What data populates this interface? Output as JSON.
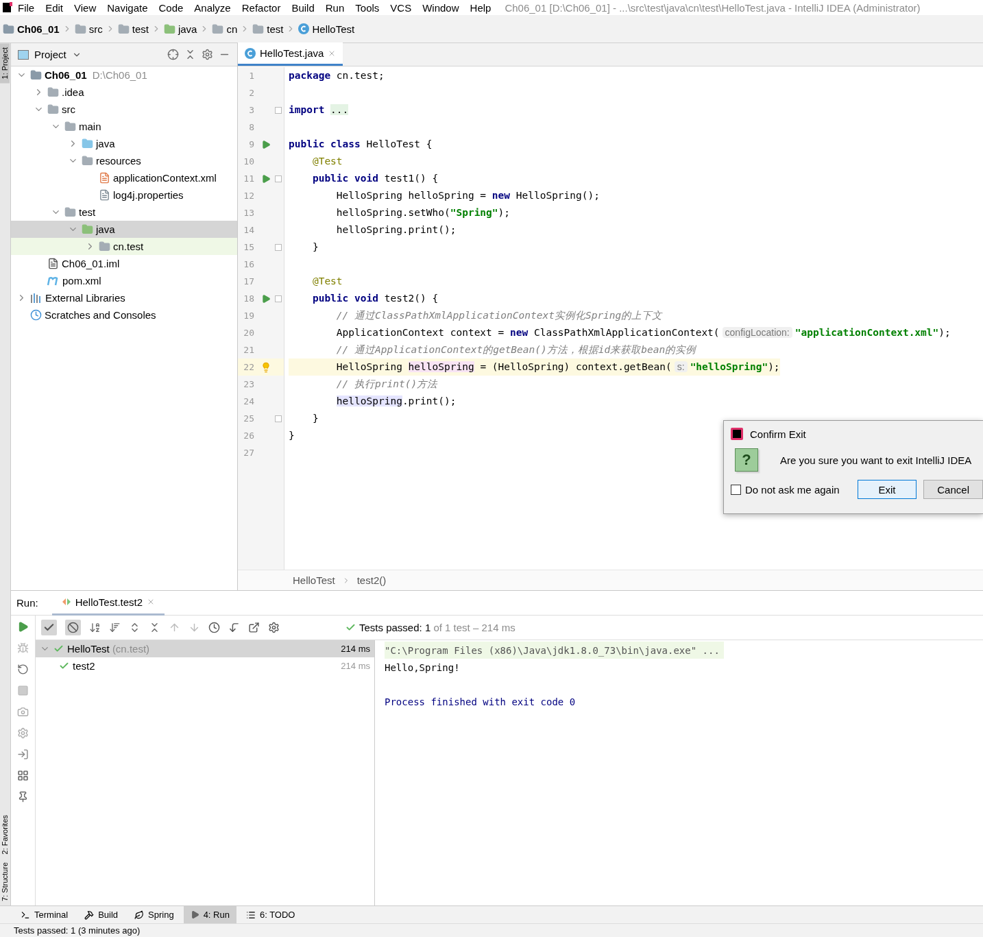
{
  "menu": [
    "File",
    "Edit",
    "View",
    "Navigate",
    "Code",
    "Analyze",
    "Refactor",
    "Build",
    "Run",
    "Tools",
    "VCS",
    "Window",
    "Help"
  ],
  "window": {
    "title": "Ch06_01 [D:\\Ch06_01] - ...\\src\\test\\java\\cn\\test\\HelloTest.java - IntelliJ IDEA (Administrator)"
  },
  "breadcrumbs": [
    {
      "label": "Ch06_01",
      "kind": "module"
    },
    {
      "label": "src",
      "kind": "folder"
    },
    {
      "label": "test",
      "kind": "folder"
    },
    {
      "label": "java",
      "kind": "test-folder"
    },
    {
      "label": "cn",
      "kind": "package"
    },
    {
      "label": "test",
      "kind": "package"
    },
    {
      "label": "HelloTest",
      "kind": "class"
    }
  ],
  "side_strip": {
    "top": [
      {
        "label": "1: Project",
        "selected": true
      }
    ],
    "bottom": [
      {
        "label": "2: Favorites",
        "selected": false
      },
      {
        "label": "7: Structure",
        "selected": false
      }
    ]
  },
  "project": {
    "title": "Project",
    "tree": [
      {
        "label": "Ch06_01",
        "path": "D:\\Ch06_01",
        "kind": "module",
        "expanded": true,
        "selected": false,
        "children": [
          {
            "label": ".idea",
            "kind": "folder",
            "expanded": false,
            "selected": false
          },
          {
            "label": "src",
            "kind": "folder",
            "expanded": true,
            "selected": false,
            "children": [
              {
                "label": "main",
                "kind": "folder",
                "expanded": true,
                "selected": false,
                "children": [
                  {
                    "label": "java",
                    "kind": "source-folder",
                    "expanded": false,
                    "selected": false
                  },
                  {
                    "label": "resources",
                    "kind": "resources-folder",
                    "expanded": true,
                    "selected": false,
                    "children": [
                      {
                        "label": "applicationContext.xml",
                        "kind": "xml",
                        "selected": false
                      },
                      {
                        "label": "log4j.properties",
                        "kind": "properties",
                        "selected": false
                      }
                    ]
                  }
                ]
              },
              {
                "label": "test",
                "kind": "folder",
                "expanded": true,
                "selected": false,
                "children": [
                  {
                    "label": "java",
                    "kind": "test-folder",
                    "expanded": true,
                    "selected": true,
                    "children": [
                      {
                        "label": "cn.test",
                        "kind": "package",
                        "expanded": false,
                        "selected": false,
                        "tinted": true
                      }
                    ]
                  }
                ]
              }
            ]
          },
          {
            "label": "Ch06_01.iml",
            "kind": "iml",
            "selected": false
          },
          {
            "label": "pom.xml",
            "kind": "maven",
            "selected": false
          }
        ]
      },
      {
        "label": "External Libraries",
        "kind": "libraries",
        "expanded": false,
        "selected": false
      },
      {
        "label": "Scratches and Consoles",
        "kind": "scratches",
        "selected": false
      }
    ]
  },
  "editor": {
    "tabs": [
      {
        "label": "HelloTest.java",
        "selected": true
      }
    ],
    "lines": [
      {
        "number": "1",
        "tokens": [
          {
            "kind": "kw",
            "text": "package"
          },
          {
            "kind": "plain",
            "text": " cn.test;"
          }
        ]
      },
      {
        "number": "2"
      },
      {
        "number": "3",
        "fold": true,
        "tokens": [
          {
            "kind": "kw",
            "text": "import "
          },
          {
            "kind": "folded",
            "text": "..."
          }
        ]
      },
      {
        "number": "8"
      },
      {
        "number": "9",
        "runnable": true,
        "tokens": [
          {
            "kind": "kw",
            "text": "public class"
          },
          {
            "kind": "plain",
            "text": " HelloTest {"
          }
        ]
      },
      {
        "number": "10",
        "tokens": [
          {
            "kind": "annotation",
            "text": "    @Test"
          }
        ]
      },
      {
        "number": "11",
        "runnable": true,
        "fold": true,
        "tokens": [
          {
            "kind": "kw",
            "text": "    public void"
          },
          {
            "kind": "plain",
            "text": " test1() {"
          }
        ]
      },
      {
        "number": "12",
        "tokens": [
          {
            "kind": "plain",
            "text": "        HelloSpring helloSpring = "
          },
          {
            "kind": "kw",
            "text": "new"
          },
          {
            "kind": "plain",
            "text": " HelloSpring();"
          }
        ]
      },
      {
        "number": "13",
        "tokens": [
          {
            "kind": "plain",
            "text": "        helloSpring.setWho("
          },
          {
            "kind": "string",
            "text": "\"Spring\""
          },
          {
            "kind": "plain",
            "text": ");"
          }
        ]
      },
      {
        "number": "14",
        "tokens": [
          {
            "kind": "plain",
            "text": "        helloSpring.print();"
          }
        ]
      },
      {
        "number": "15",
        "fold": true,
        "tokens": [
          {
            "kind": "plain",
            "text": "    }"
          }
        ]
      },
      {
        "number": "16"
      },
      {
        "number": "17",
        "tokens": [
          {
            "kind": "annotation",
            "text": "    @Test"
          }
        ]
      },
      {
        "number": "18",
        "runnable": true,
        "fold": true,
        "tokens": [
          {
            "kind": "kw",
            "text": "    public void"
          },
          {
            "kind": "plain",
            "text": " test2() {"
          }
        ]
      },
      {
        "number": "19",
        "tokens": [
          {
            "kind": "comment",
            "text": "        // 通过ClassPathXmlApplicationContext实例化Spring的上下文"
          }
        ]
      },
      {
        "number": "20",
        "tokens": [
          {
            "kind": "plain",
            "text": "        ApplicationContext context = "
          },
          {
            "kind": "kw",
            "text": "new"
          },
          {
            "kind": "plain",
            "text": " ClassPathXmlApplicationContext("
          },
          {
            "kind": "hint",
            "text": "configLocation:"
          },
          {
            "kind": "string",
            "text": "\"applicationContext.xml\""
          },
          {
            "kind": "plain",
            "text": ");"
          }
        ]
      },
      {
        "number": "21",
        "tokens": [
          {
            "kind": "comment",
            "text": "        // 通过ApplicationContext的getBean()方法，根据id来获取bean的实例"
          }
        ]
      },
      {
        "number": "22",
        "bulb": true,
        "current": true,
        "tokens": [
          {
            "kind": "plain",
            "text": "        HelloSpring "
          },
          {
            "kind": "write",
            "text": "helloSpring"
          },
          {
            "kind": "plain",
            "text": " = (HelloSpring) context.getBean("
          },
          {
            "kind": "hint",
            "text": "s:"
          },
          {
            "kind": "string",
            "text": "\"helloSpring\""
          },
          {
            "kind": "plain",
            "text": ");"
          }
        ]
      },
      {
        "number": "23",
        "tokens": [
          {
            "kind": "comment",
            "text": "        // 执行print()方法"
          }
        ]
      },
      {
        "number": "24",
        "tokens": [
          {
            "kind": "read",
            "text": "        helloSpring"
          },
          {
            "kind": "plain",
            "text": ".print();"
          }
        ]
      },
      {
        "number": "25",
        "fold": true,
        "tokens": [
          {
            "kind": "plain",
            "text": "    }"
          }
        ]
      },
      {
        "number": "26",
        "tokens": [
          {
            "kind": "plain",
            "text": "}"
          }
        ]
      },
      {
        "number": "27"
      }
    ],
    "breadcrumbs": [
      "HelloTest",
      "test2()"
    ]
  },
  "dialog": {
    "title": "Confirm Exit",
    "icon": "?",
    "message": "Are you sure you want to exit IntelliJ IDEA",
    "checkbox": {
      "label": "Do not ask me again",
      "checked": false
    },
    "buttons": [
      {
        "label": "Exit",
        "default": true
      },
      {
        "label": "Cancel",
        "default": false
      }
    ]
  },
  "run": {
    "label": "Run:",
    "tabs": [
      {
        "label": "HelloTest.test2",
        "selected": true
      }
    ],
    "summary": {
      "status": "Tests passed:",
      "passed": "1",
      "rest": "of 1 test – 214 ms"
    },
    "tests": [
      {
        "name": "HelloTest",
        "package": "(cn.test)",
        "time": "214 ms",
        "passed": true,
        "selected": true,
        "expanded": true,
        "children": [
          {
            "name": "test2",
            "time": "214 ms",
            "passed": true,
            "selected": false
          }
        ]
      }
    ],
    "console": [
      {
        "kind": "command",
        "text": "\"C:\\Program Files (x86)\\Java\\jdk1.8.0_73\\bin\\java.exe\" ..."
      },
      {
        "kind": "output",
        "text": "Hello,Spring!"
      },
      {
        "kind": "system",
        "text": "Process finished with exit code 0"
      }
    ]
  },
  "tool_tabs": [
    {
      "label": "Terminal",
      "kind": "terminal",
      "selected": false
    },
    {
      "label": "Build",
      "kind": "build",
      "selected": false
    },
    {
      "label": "Spring",
      "kind": "spring",
      "selected": false
    },
    {
      "label": "4: Run",
      "kind": "run",
      "selected": true
    },
    {
      "label": "6: TODO",
      "kind": "todo",
      "selected": false
    }
  ],
  "status_bar": {
    "text": "Tests passed: 1 (3 minutes ago)"
  }
}
